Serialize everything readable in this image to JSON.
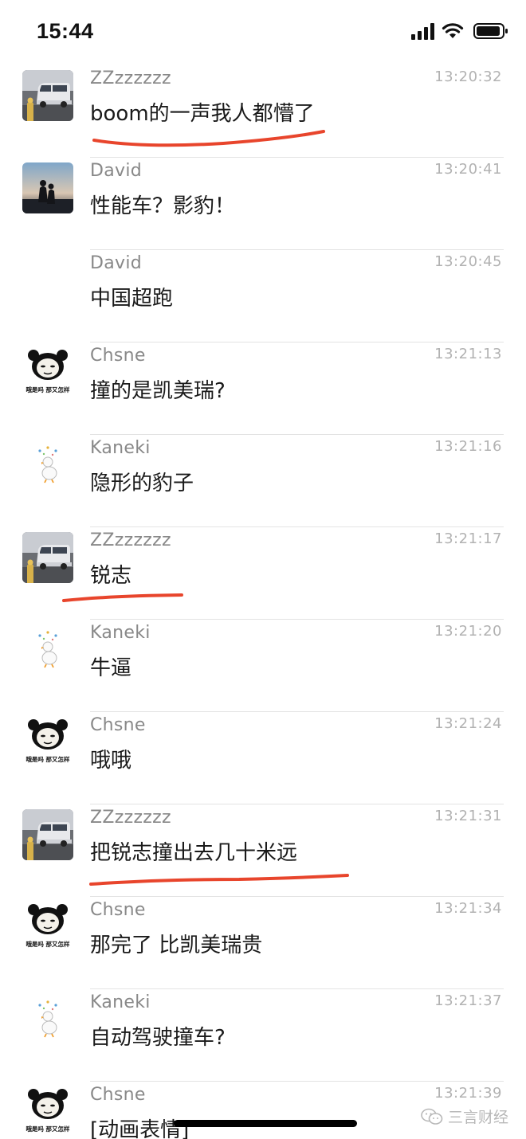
{
  "status_bar": {
    "time": "15:44"
  },
  "messages": [
    {
      "sender": "ZZzzzzzz",
      "time": "13:20:32",
      "text": "boom的一声我人都懵了",
      "avatar": "van-avatar"
    },
    {
      "sender": "David",
      "time": "13:20:41",
      "text": "性能车？影豹！",
      "avatar": "couple-sunset-avatar"
    },
    {
      "sender": "David",
      "time": "13:20:45",
      "text": "中国超跑",
      "avatar": ""
    },
    {
      "sender": "Chsne",
      "time": "13:21:13",
      "text": "撞的是凯美瑞?",
      "avatar": "panda-meme-avatar",
      "avatar_caption": "哦是吗 那又怎样"
    },
    {
      "sender": "Kaneki",
      "time": "13:21:16",
      "text": "隐形的豹子",
      "avatar": "duck-avatar"
    },
    {
      "sender": "ZZzzzzzz",
      "time": "13:21:17",
      "text": "锐志",
      "avatar": "van-avatar"
    },
    {
      "sender": "Kaneki",
      "time": "13:21:20",
      "text": "牛逼",
      "avatar": "duck-avatar"
    },
    {
      "sender": "Chsne",
      "time": "13:21:24",
      "text": "哦哦",
      "avatar": "panda-meme-avatar",
      "avatar_caption": "哦是吗 那又怎样"
    },
    {
      "sender": "ZZzzzzzz",
      "time": "13:21:31",
      "text": "把锐志撞出去几十米远",
      "avatar": "van-avatar"
    },
    {
      "sender": "Chsne",
      "time": "13:21:34",
      "text": "那完了 比凯美瑞贵",
      "avatar": "panda-meme-avatar",
      "avatar_caption": "哦是吗 那又怎样"
    },
    {
      "sender": "Kaneki",
      "time": "13:21:37",
      "text": "自动驾驶撞车?",
      "avatar": "duck-avatar"
    },
    {
      "sender": "Chsne",
      "time": "13:21:39",
      "text": "[动画表情]",
      "avatar": "panda-meme-avatar",
      "avatar_caption": "哦是吗 那又怎样"
    }
  ],
  "watermark": {
    "text": "三言财经"
  },
  "colors": {
    "underline": "#e8452c",
    "sender": "#888888",
    "timestamp": "#b2b2b2"
  }
}
